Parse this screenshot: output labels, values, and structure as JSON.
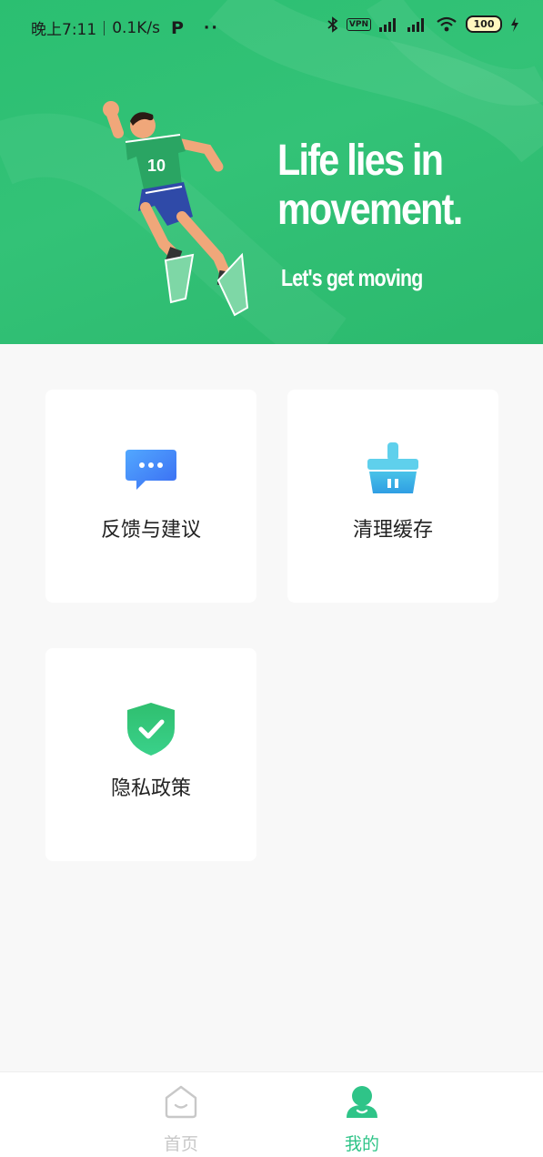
{
  "status_bar": {
    "time": "晚上7:11",
    "speed": "0.1K/s",
    "p_label": "P",
    "dots": "··",
    "vpn": "VPN",
    "battery": "100"
  },
  "hero": {
    "title_line1": "Life lies in",
    "title_line2": "movement.",
    "subtitle": "Let's get moving",
    "jersey_number": "10"
  },
  "menu": {
    "feedback_label": "反馈与建议",
    "clear_cache_label": "清理缓存",
    "privacy_label": "隐私政策"
  },
  "bottom_nav": {
    "home_label": "首页",
    "mine_label": "我的",
    "active": "mine"
  },
  "colors": {
    "brand_green": "#2bbf71",
    "nav_active": "#2fc488",
    "nav_inactive": "#c8c8c8"
  }
}
